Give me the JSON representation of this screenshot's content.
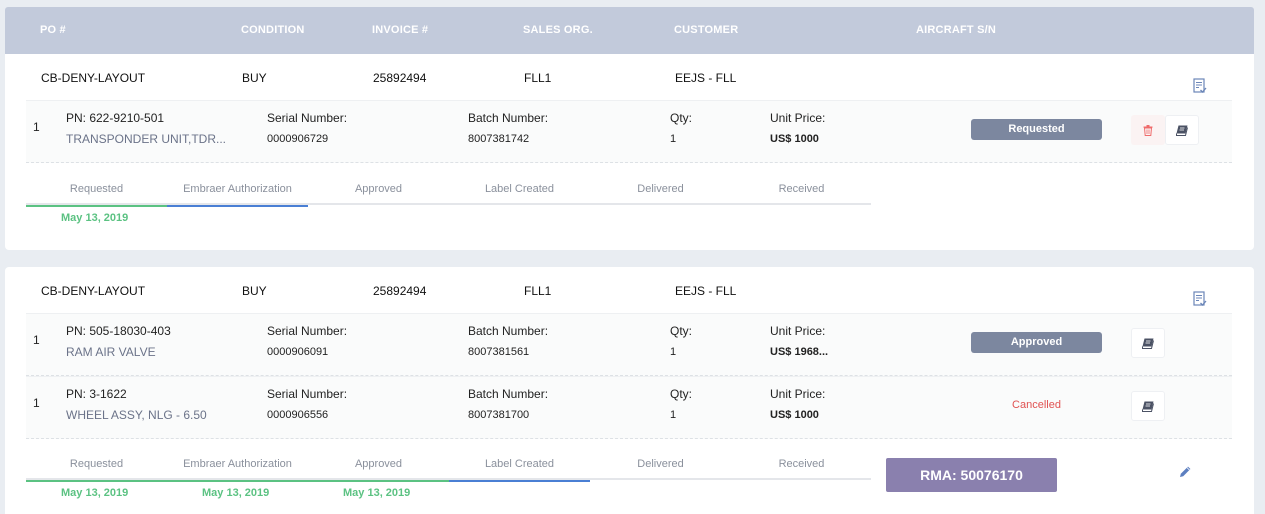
{
  "header": {
    "po": "PO #",
    "condition": "CONDITION",
    "invoice": "INVOICE #",
    "sales_org": "SALES ORG.",
    "customer": "CUSTOMER",
    "aircraft": "AIRCRAFT S/N"
  },
  "orders": [
    {
      "po": "CB-DENY-LAYOUT",
      "condition": "BUY",
      "invoice": "25892494",
      "sales_org": "FLL1",
      "customer": "EEJS - FLL",
      "items": [
        {
          "index": "1",
          "pn": "PN: 622-9210-501",
          "description": "TRANSPONDER UNIT,TDR...",
          "serial_label": "Serial Number:",
          "serial": "0000906729",
          "batch_label": "Batch Number:",
          "batch": "8007381742",
          "qty_label": "Qty:",
          "qty": "1",
          "price_label": "Unit Price:",
          "price": "US$ 1000",
          "status": "Requested"
        }
      ],
      "steps": [
        "Requested",
        "Embraer Authorization",
        "Approved",
        "Label Created",
        "Delivered",
        "Received"
      ],
      "dates": [
        "May 13, 2019"
      ]
    },
    {
      "po": "CB-DENY-LAYOUT",
      "condition": "BUY",
      "invoice": "25892494",
      "sales_org": "FLL1",
      "customer": "EEJS - FLL",
      "items": [
        {
          "index": "1",
          "pn": "PN: 505-18030-403",
          "description": "RAM AIR VALVE",
          "serial_label": "Serial Number:",
          "serial": "0000906091",
          "batch_label": "Batch Number:",
          "batch": "8007381561",
          "qty_label": "Qty:",
          "qty": "1",
          "price_label": "Unit Price:",
          "price": "US$ 1968...",
          "status": "Approved"
        },
        {
          "index": "1",
          "pn": "PN: 3-1622",
          "description": "WHEEL ASSY, NLG - 6.50",
          "serial_label": "Serial Number:",
          "serial": "0000906556",
          "batch_label": "Batch Number:",
          "batch": "8007381700",
          "qty_label": "Qty:",
          "qty": "1",
          "price_label": "Unit Price:",
          "price": "US$ 1000",
          "status": "Cancelled"
        }
      ],
      "steps": [
        "Requested",
        "Embraer Authorization",
        "Approved",
        "Label Created",
        "Delivered",
        "Received"
      ],
      "dates": [
        "May 13, 2019",
        "May 13, 2019",
        "May 13, 2019"
      ],
      "rma": "RMA: 50076170"
    }
  ],
  "colors": {
    "header_bg": "#c2cadb",
    "badge_bg": "#7c879f",
    "cancelled": "#e05252",
    "date_green": "#5bc282",
    "step_green": "#5bc282",
    "step_blue": "#4a7fd4",
    "rma_bg": "#8a80ae"
  },
  "progress": [
    {
      "completed_steps": 1,
      "current_step": "Embraer Authorization"
    },
    {
      "completed_steps": 3,
      "current_step": "Label Created"
    }
  ]
}
